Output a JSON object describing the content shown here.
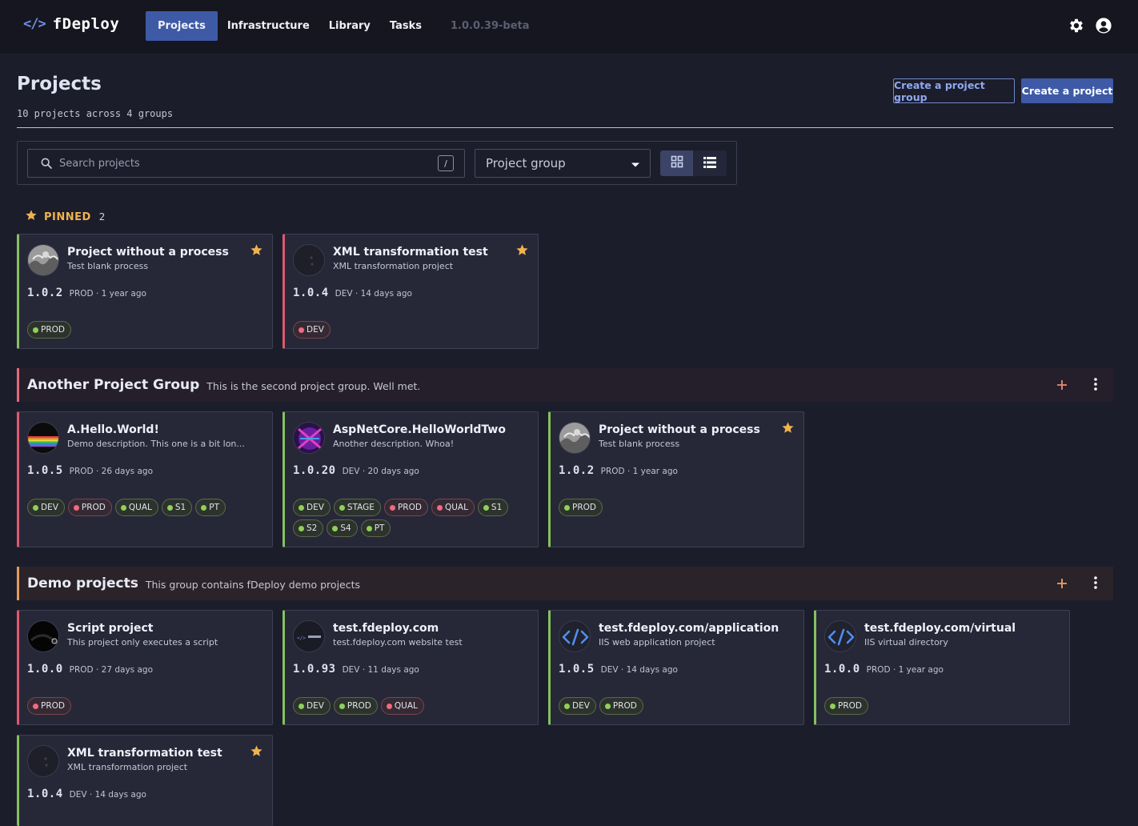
{
  "nav": {
    "logo_glyph": "</>",
    "brand": "fDeploy",
    "links": [
      "Projects",
      "Infrastructure",
      "Library",
      "Tasks"
    ],
    "active_link": "Projects",
    "version": "1.0.0.39-beta",
    "icons": [
      "gear-icon",
      "user-circle-icon"
    ]
  },
  "header": {
    "title": "Projects",
    "subtitle": "10 projects across 4 groups",
    "create_group_label": "Create a project group",
    "create_project_label": "Create a project"
  },
  "filters": {
    "search_placeholder": "Search projects",
    "search_shortcut": "/",
    "group_select_value": "Project group",
    "view_modes": [
      "grid",
      "list"
    ],
    "active_view": "grid"
  },
  "pinned": {
    "label": "PINNED",
    "count": "2",
    "projects": [
      {
        "name": "Project without a process",
        "description": "Test blank process",
        "version": "1.0.2",
        "meta": "PROD · 1 year ago",
        "starred": true,
        "tags": [
          {
            "label": "PROD",
            "status": "success"
          }
        ]
      },
      {
        "name": "XML transformation test",
        "description": "XML transformation project",
        "version": "1.0.4",
        "meta": "DEV · 14 days ago",
        "starred": true,
        "tags": [
          {
            "label": "DEV",
            "status": "failed"
          }
        ]
      }
    ]
  },
  "groups": [
    {
      "name": "Another Project Group",
      "description": "This is the second project group. Well met.",
      "projects": [
        {
          "name": "A.Hello.World!",
          "description": "Demo description. This one is a bit lon...",
          "version": "1.0.5",
          "meta": "PROD · 26 days ago",
          "starred": false,
          "tags": [
            {
              "label": "DEV",
              "status": "success"
            },
            {
              "label": "PROD",
              "status": "failed"
            },
            {
              "label": "QUAL",
              "status": "success"
            },
            {
              "label": "S1",
              "status": "success"
            },
            {
              "label": "PT",
              "status": "success"
            }
          ]
        },
        {
          "name": "AspNetCore.HelloWorldTwo",
          "description": "Another description. Whoa!",
          "version": "1.0.20",
          "meta": "DEV · 20 days ago",
          "starred": false,
          "tags": [
            {
              "label": "DEV",
              "status": "success"
            },
            {
              "label": "STAGE",
              "status": "success"
            },
            {
              "label": "PROD",
              "status": "failed"
            },
            {
              "label": "QUAL",
              "status": "failed"
            },
            {
              "label": "S1",
              "status": "success"
            },
            {
              "label": "S2",
              "status": "success"
            },
            {
              "label": "S4",
              "status": "success"
            },
            {
              "label": "PT",
              "status": "success"
            }
          ]
        },
        {
          "name": "Project without a process",
          "description": "Test blank process",
          "version": "1.0.2",
          "meta": "PROD · 1 year ago",
          "starred": true,
          "tags": [
            {
              "label": "PROD",
              "status": "success"
            }
          ]
        }
      ]
    },
    {
      "name": "Demo projects",
      "description": "This group contains fDeploy demo projects",
      "projects": [
        {
          "name": "Script project",
          "description": "This project only executes a script",
          "version": "1.0.0",
          "meta": "PROD · 27 days ago",
          "starred": false,
          "tags": [
            {
              "label": "PROD",
              "status": "failed"
            }
          ]
        },
        {
          "name": "test.fdeploy.com",
          "description": "test.fdeploy.com website test",
          "version": "1.0.93",
          "meta": "DEV · 11 days ago",
          "starred": false,
          "tags": [
            {
              "label": "DEV",
              "status": "success"
            },
            {
              "label": "PROD",
              "status": "success"
            },
            {
              "label": "QUAL",
              "status": "failed"
            }
          ]
        },
        {
          "name": "test.fdeploy.com/application",
          "description": "IIS web application project",
          "version": "1.0.5",
          "meta": "DEV · 14 days ago",
          "starred": false,
          "tags": [
            {
              "label": "DEV",
              "status": "success"
            },
            {
              "label": "PROD",
              "status": "success"
            }
          ]
        },
        {
          "name": "test.fdeploy.com/virtual",
          "description": "IIS virtual directory",
          "version": "1.0.0",
          "meta": "PROD · 1 year ago",
          "starred": false,
          "tags": [
            {
              "label": "PROD",
              "status": "success"
            }
          ]
        },
        {
          "name": "XML transformation test",
          "description": "XML transformation project",
          "version": "1.0.4",
          "meta": "DEV · 14 days ago",
          "starred": true,
          "tags": []
        }
      ]
    }
  ],
  "colors": {
    "accent": "#3e5aa6",
    "success": "#8fd05c",
    "failed": "#f06a80",
    "pinned": "#f0b34d"
  }
}
